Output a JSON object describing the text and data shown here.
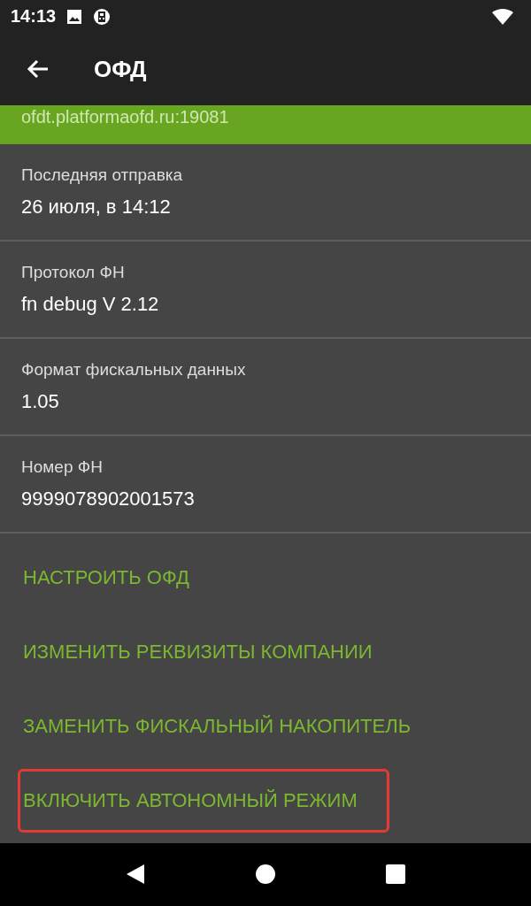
{
  "status_bar": {
    "time": "14:13"
  },
  "app_bar": {
    "title": "ОФД"
  },
  "server": {
    "address": "ofdt.platformaofd.ru:19081"
  },
  "fields": [
    {
      "label": "Последняя отправка",
      "value": "26 июля, в 14:12"
    },
    {
      "label": "Протокол ФН",
      "value": "fn debug V 2.12"
    },
    {
      "label": "Формат фискальных данных",
      "value": "1.05"
    },
    {
      "label": "Номер ФН",
      "value": "9999078902001573"
    }
  ],
  "actions": [
    {
      "label": "НАСТРОИТЬ ОФД",
      "highlighted": false
    },
    {
      "label": "ИЗМЕНИТЬ РЕКВИЗИТЫ КОМПАНИИ",
      "highlighted": false
    },
    {
      "label": "ЗАМЕНИТЬ ФИСКАЛЬНЫЙ НАКОПИТЕЛЬ",
      "highlighted": false
    },
    {
      "label": "ВКЛЮЧИТЬ АВТОНОМНЫЙ РЕЖИМ",
      "highlighted": true
    }
  ]
}
